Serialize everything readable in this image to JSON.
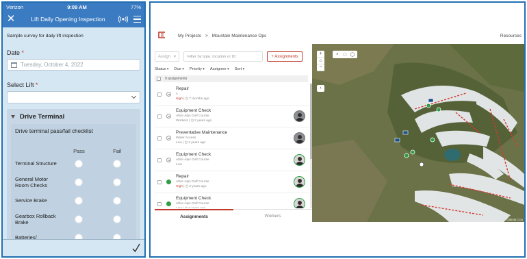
{
  "phone": {
    "status": {
      "carrier": "Verizon",
      "time": "9:09 AM",
      "battery": "77%"
    },
    "header": {
      "title": "Lift Daily Opening Inspection"
    },
    "survey_desc": "Sample survey for daily lift inspection",
    "date_question": {
      "label": "Date",
      "required_mark": "*",
      "value": "Tuesday, October 4, 2022"
    },
    "lift_question": {
      "label": "Select Lift",
      "required_mark": "*"
    },
    "group": {
      "title": "Drive Terminal",
      "grid_title": "Drive terminal pass/fail checklist",
      "col_pass": "Pass",
      "col_fail": "Fail",
      "rows": [
        "Terminal Structure",
        "General Motor Room Checks",
        "Service Brake",
        "Gearbox Rollback Brake",
        "Batteries/"
      ]
    }
  },
  "app": {
    "breadcrumb": {
      "root": "My Projects",
      "sep": ">",
      "current": "Mountain Maintenance Ops"
    },
    "top_right": "Resources",
    "toolbar": {
      "assign_label": "Assign",
      "filter_placeholder": "Filter by type, location or ID",
      "new_assignments_label": "+ Assignments"
    },
    "filters": [
      "Status",
      "Due",
      "Priority",
      "Assignee",
      "Sort"
    ],
    "selection": {
      "count_label": "9 assignments"
    },
    "assignments": [
      {
        "title": "Repair",
        "location": "4",
        "priority": "High",
        "age": "7 months ago",
        "status": "prog",
        "worker": "none"
      },
      {
        "title": "Equipment Check",
        "location": "Afton Alps Golf Course",
        "priority": "Workers",
        "age": "2 years ago",
        "status": "prog",
        "worker": "grey"
      },
      {
        "title": "Preventative Maintenance",
        "location": "Water Access",
        "priority": "Low",
        "age": "2 years ago",
        "status": "prog",
        "worker": "grey"
      },
      {
        "title": "Equipment Check",
        "location": "Afton Alps Golf Course",
        "priority": "Low",
        "age": "",
        "status": "prog",
        "worker": "green"
      },
      {
        "title": "Repair",
        "location": "Afton Alps Golf Course",
        "priority": "High",
        "age": "2 years ago",
        "status": "done",
        "worker": "green"
      },
      {
        "title": "Equipment Check",
        "location": "Afton Alps Golf Course",
        "priority": "Low",
        "age": "2 years ago",
        "status": "done",
        "worker": "green"
      }
    ],
    "tabs": [
      "Assignments",
      "Workers"
    ],
    "map": {
      "attribution": "Dakota Cou"
    },
    "colors": {
      "brand_red": "#c0392b",
      "panel_border": "#1f6fb2",
      "phone_header": "#3b7bc1",
      "complete_green": "#2e9e45"
    }
  }
}
